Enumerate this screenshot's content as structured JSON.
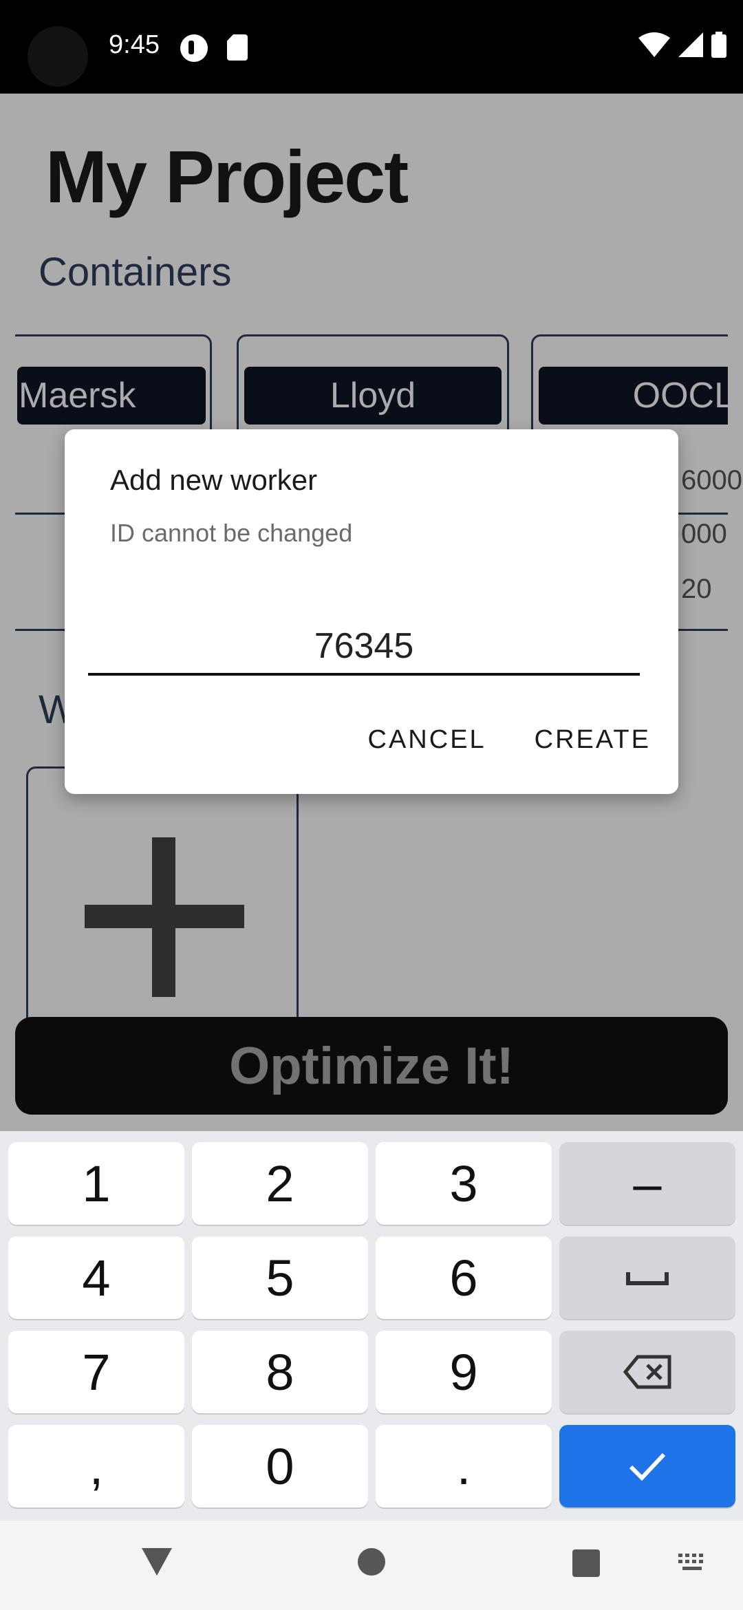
{
  "status_bar": {
    "time": "9:45"
  },
  "app": {
    "title": "My Project",
    "containers_label": "Containers",
    "containers": [
      {
        "name": "Maersk"
      },
      {
        "name": "Lloyd"
      },
      {
        "name": "OOCL",
        "values": [
          "6000",
          "000",
          "20"
        ]
      }
    ],
    "workers_label": "W",
    "optimize_label": "Optimize It!"
  },
  "dialog": {
    "title": "Add new worker",
    "subtitle": "ID cannot be changed",
    "input_value": "76345",
    "cancel_label": "CANCEL",
    "create_label": "CREATE"
  },
  "keyboard": {
    "keys": [
      "1",
      "2",
      "3",
      "–",
      "4",
      "5",
      "6",
      "␣",
      "7",
      "8",
      "9",
      "⌫",
      ",",
      "0",
      ".",
      "✓"
    ]
  },
  "colors": {
    "accent": "#1f73e8",
    "tag_bg": "#0f1626",
    "heading": "#2e3f5c"
  }
}
